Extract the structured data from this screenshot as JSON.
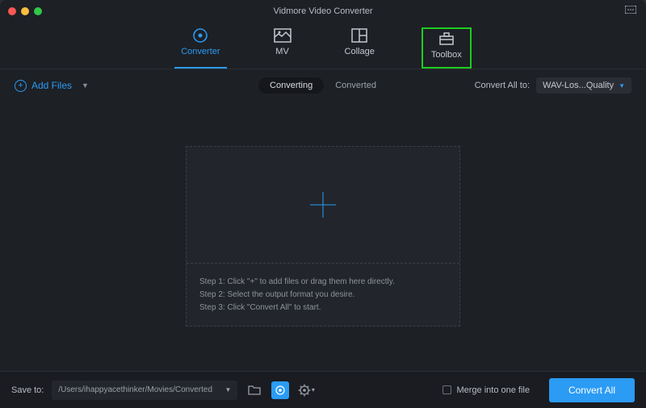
{
  "title": "Vidmore Video Converter",
  "nav": {
    "converter": "Converter",
    "mv": "MV",
    "collage": "Collage",
    "toolbox": "Toolbox"
  },
  "addFiles": "Add Files",
  "subtabs": {
    "converting": "Converting",
    "converted": "Converted"
  },
  "convertAllTo": {
    "label": "Convert All to:",
    "value": "WAV-Los...Quality"
  },
  "steps": {
    "s1": "Step 1: Click \"+\" to add files or drag them here directly.",
    "s2": "Step 2: Select the output format you desire.",
    "s3": "Step 3: Click \"Convert All\" to start."
  },
  "saveTo": {
    "label": "Save to:",
    "path": "/Users/ihappyacethinker/Movies/Converted"
  },
  "merge": "Merge into one file",
  "convertAll": "Convert All"
}
